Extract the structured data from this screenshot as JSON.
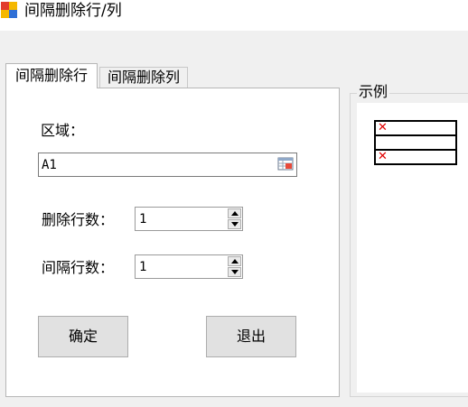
{
  "window": {
    "title": "间隔删除行/列"
  },
  "tabs": [
    {
      "label": "间隔删除行",
      "active": true
    },
    {
      "label": "间隔删除列",
      "active": false
    }
  ],
  "form": {
    "region_label": "区域：",
    "region_value": "A1",
    "delete_rows_label": "删除行数：",
    "delete_rows_value": "1",
    "interval_rows_label": "间隔行数：",
    "interval_rows_value": "1",
    "confirm_label": "确定",
    "exit_label": "退出"
  },
  "example": {
    "title": "示例",
    "rows": [
      {
        "marked": true,
        "mark": "✕"
      },
      {
        "marked": false,
        "mark": ""
      },
      {
        "marked": true,
        "mark": "✕"
      }
    ]
  },
  "colors": {
    "window_bg": "#f0f0f0",
    "panel_bg": "#ffffff",
    "mark_red": "#e00000",
    "button_bg": "#e1e1e1"
  }
}
